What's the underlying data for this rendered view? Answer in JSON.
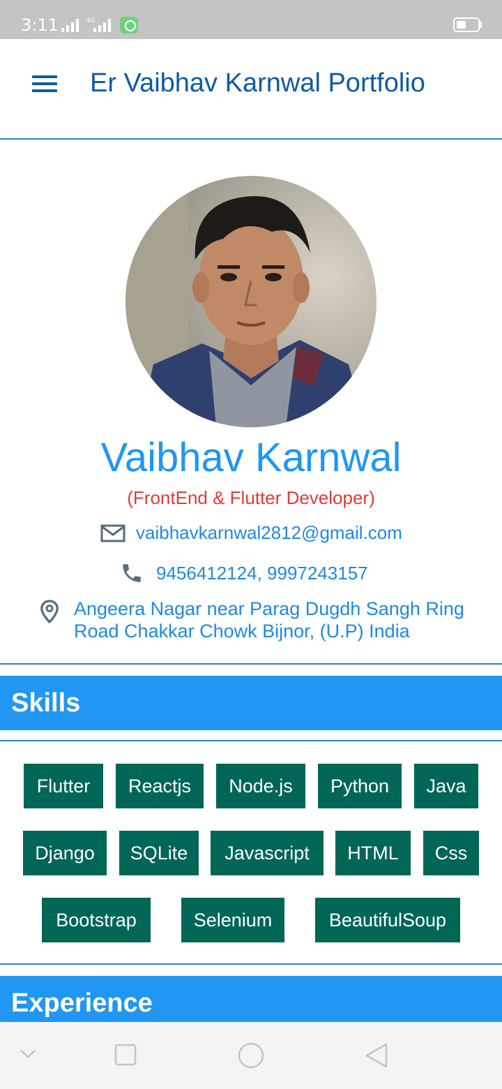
{
  "status_bar": {
    "time": "3:11",
    "network_label": "4G"
  },
  "app_bar": {
    "title": "Er Vaibhav Karnwal Portfolio",
    "menu_icon": "hamburger-menu-icon"
  },
  "profile": {
    "name": "Vaibhav Karnwal",
    "role": "(FrontEnd & Flutter Developer)",
    "email": "vaibhavkarnwal2812@gmail.com",
    "phone": "9456412124, 9997243157",
    "address": "Angeera Nagar near Parag Dugdh Sangh Ring Road  Chakkar Chowk Bijnor, (U.P) India"
  },
  "skills": {
    "title": "Skills",
    "items": [
      "Flutter",
      "Reactjs",
      "Node.js",
      "Python",
      "Java",
      "Django",
      "SQLite",
      "Javascript",
      "HTML",
      "Css",
      "Bootstrap",
      "Selenium",
      "BeautifulSoup"
    ]
  },
  "experience": {
    "title": "Experience"
  },
  "colors": {
    "primary": "#2196f3",
    "title_blue": "#0d5aa7",
    "role_red": "#e53935",
    "chip": "#006656"
  }
}
